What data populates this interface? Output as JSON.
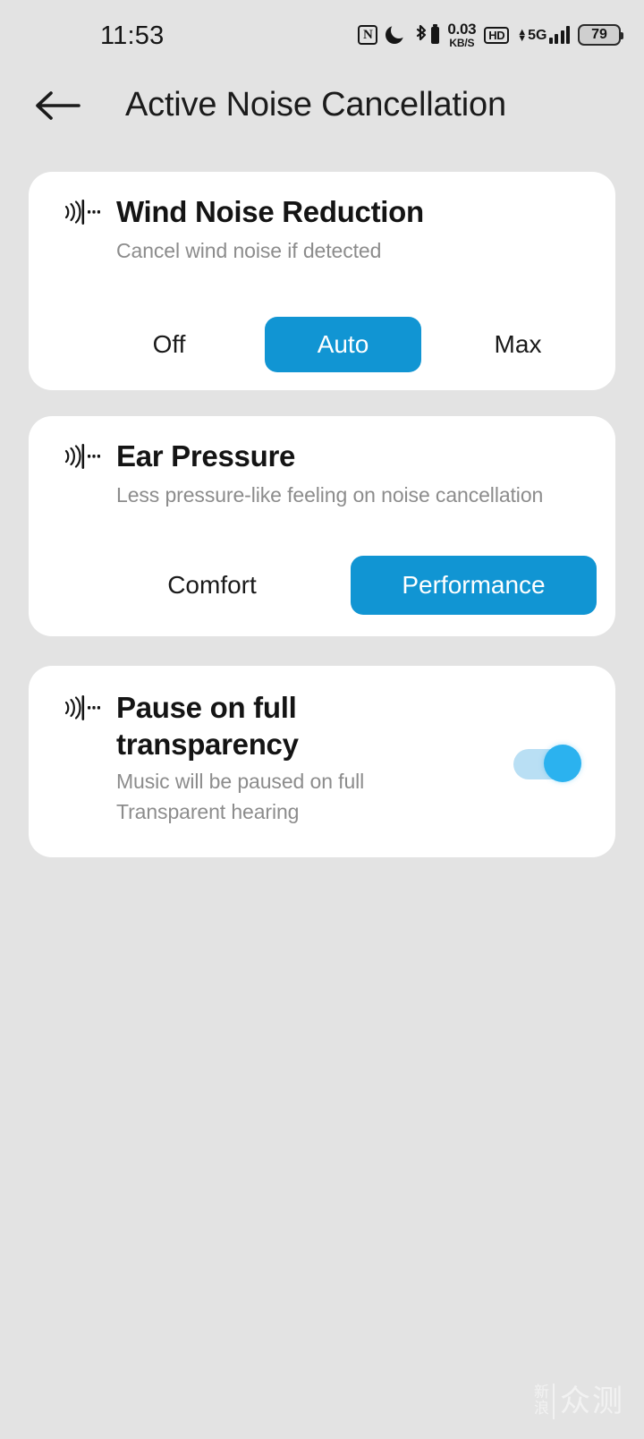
{
  "status_bar": {
    "time": "11:53",
    "icons": [
      {
        "name": "nfc-icon",
        "label": "N"
      },
      {
        "name": "do-not-disturb-moon-icon",
        "label": ""
      },
      {
        "name": "bluetooth-icon",
        "label": ""
      },
      {
        "name": "network-speed-indicator",
        "label": "0.03 KB/S"
      },
      {
        "name": "hd-voice-icon",
        "label": "HD"
      },
      {
        "name": "cellular-5g-signal-icon",
        "label": "5G"
      },
      {
        "name": "battery-icon",
        "label": "79"
      }
    ],
    "network_speed_value": "0.03",
    "network_speed_unit": "KB/S",
    "hd_badge": "HD",
    "network_type": "5G",
    "battery_level": "79"
  },
  "appbar": {
    "back_label": "Back",
    "title": "Active Noise Cancellation"
  },
  "cards": {
    "wind": {
      "title": "Wind Noise Reduction",
      "subtitle": "Cancel wind noise if detected",
      "options": [
        "Off",
        "Auto",
        "Max"
      ],
      "selected": "Auto"
    },
    "ear": {
      "title": "Ear Pressure",
      "subtitle": "Less pressure-like feeling on noise cancellation",
      "options": [
        "Comfort",
        "Performance"
      ],
      "selected": "Performance"
    },
    "pause": {
      "title": "Pause on full\ntransparency",
      "subtitle": "Music will be paused on full\nTransparent hearing",
      "toggle_state": "on"
    }
  },
  "watermark": {
    "sina": "新浪",
    "zhongce": "众测"
  },
  "colors": {
    "accent_blue": "#1195d3",
    "toggle_thumb": "#2bb2ef",
    "toggle_track": "#b9dff4",
    "page_background": "#e3e3e3",
    "card_background": "#ffffff",
    "title_text": "#141414",
    "subtitle_text": "#8c8c8c"
  }
}
